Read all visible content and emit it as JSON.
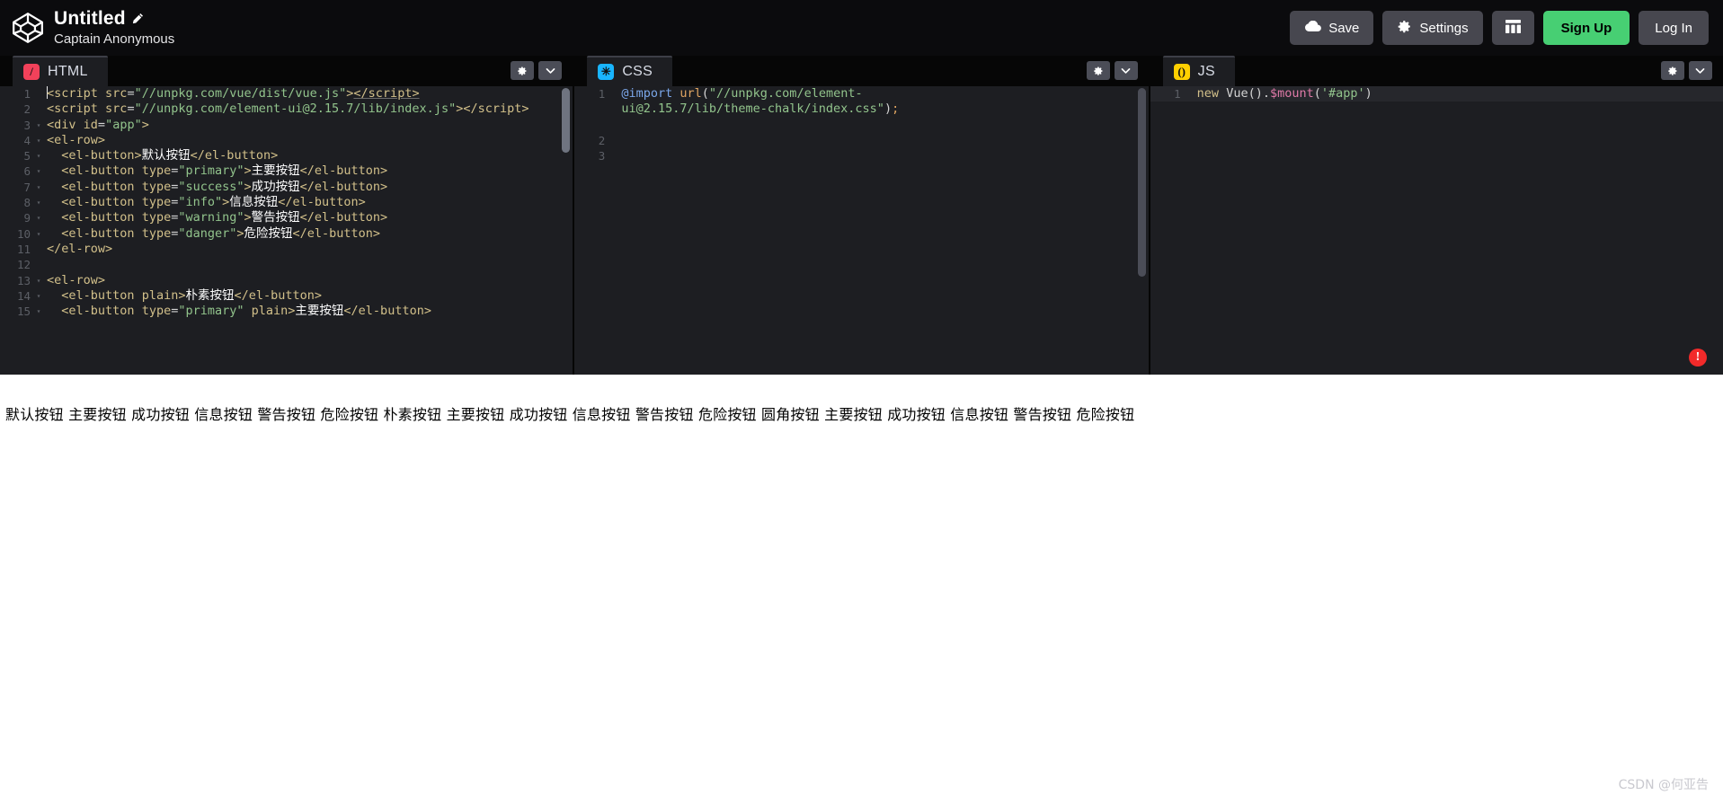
{
  "topbar": {
    "logo_icon": "codepen-cube-logo",
    "pen_title": "Untitled",
    "edit_icon": "pencil-icon",
    "author": "Captain Anonymous",
    "buttons": {
      "save": {
        "label": "Save",
        "icon": "cloud-icon"
      },
      "settings": {
        "label": "Settings",
        "icon": "gear-icon"
      },
      "layout": {
        "label": "",
        "icon": "layout-grid-icon"
      },
      "signup": {
        "label": "Sign Up",
        "color": "#47cf73"
      },
      "login": {
        "label": "Log In"
      }
    }
  },
  "panes": {
    "html": {
      "tab_label": "HTML",
      "tab_icon": "html-slash-icon",
      "icon_color": "#f2415a",
      "settings_icon": "gear-icon",
      "collapse_icon": "chevron-down-icon",
      "lines": [
        {
          "n": "1",
          "fold": false
        },
        {
          "n": "2",
          "fold": false
        },
        {
          "n": "3",
          "fold": true
        },
        {
          "n": "4",
          "fold": true
        },
        {
          "n": "5",
          "fold": true
        },
        {
          "n": "6",
          "fold": true
        },
        {
          "n": "7",
          "fold": true
        },
        {
          "n": "8",
          "fold": true
        },
        {
          "n": "9",
          "fold": true
        },
        {
          "n": "10",
          "fold": true
        },
        {
          "n": "11",
          "fold": false
        },
        {
          "n": "12",
          "fold": false
        },
        {
          "n": "13",
          "fold": true
        },
        {
          "n": "14",
          "fold": true
        },
        {
          "n": "15",
          "fold": true
        }
      ],
      "code_plain": [
        "<script src=\"//unpkg.com/vue/dist/vue.js\"></script>",
        "<script src=\"//unpkg.com/element-ui@2.15.7/lib/index.js\"></script>",
        "<div id=\"app\">",
        "<el-row>",
        "  <el-button>默认按钮</el-button>",
        "  <el-button type=\"primary\">主要按钮</el-button>",
        "  <el-button type=\"success\">成功按钮</el-button>",
        "  <el-button type=\"info\">信息按钮</el-button>",
        "  <el-button type=\"warning\">警告按钮</el-button>",
        "  <el-button type=\"danger\">危险按钮</el-button>",
        "</el-row>",
        "",
        "<el-row>",
        "  <el-button plain>朴素按钮</el-button>",
        "  <el-button type=\"primary\" plain>主要按钮</el-button>"
      ]
    },
    "css": {
      "tab_label": "CSS",
      "tab_icon": "css-asterisk-icon",
      "icon_color": "#19b5ff",
      "settings_icon": "gear-icon",
      "collapse_icon": "chevron-down-icon",
      "lines": [
        {
          "n": "1"
        },
        {
          "n": "2"
        },
        {
          "n": "3"
        }
      ],
      "code_plain": [
        "@import url(\"//unpkg.com/element-ui@2.15.7/lib/theme-chalk/index.css\");",
        "",
        ""
      ]
    },
    "js": {
      "tab_label": "JS",
      "tab_icon": "js-parens-icon",
      "icon_color": "#ffd000",
      "settings_icon": "gear-icon",
      "collapse_icon": "chevron-down-icon",
      "lines": [
        {
          "n": "1"
        }
      ],
      "code_plain": [
        "new Vue().$mount('#app')"
      ],
      "error_badge": "!"
    }
  },
  "preview": {
    "rendered_text": "默认按钮 主要按钮 成功按钮 信息按钮 警告按钮 危险按钮 朴素按钮 主要按钮 成功按钮 信息按钮 警告按钮 危险按钮 圆角按钮 主要按钮 成功按钮 信息按钮 警告按钮 危险按钮"
  },
  "watermark": "CSDN @何亚告"
}
